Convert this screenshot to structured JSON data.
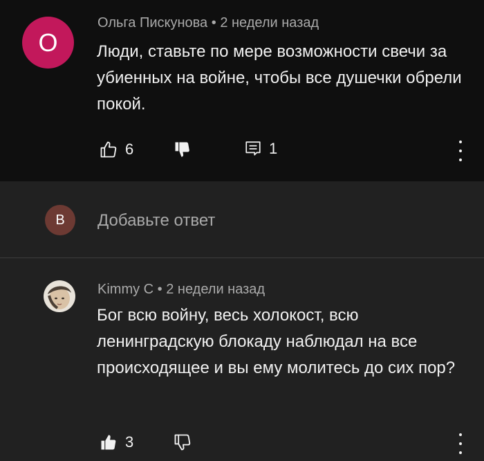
{
  "comment1": {
    "avatar_letter": "О",
    "avatar_color": "#c2185b",
    "author": "Ольга Пискунова",
    "separator": "•",
    "time": "2 недели назад",
    "text": "Люди, ставьте по мере возможности свечи за убиенных на войне, чтобы все душечки обрели покой.",
    "likes": "6",
    "replies": "1"
  },
  "reply_box": {
    "avatar_letter": "B",
    "avatar_color": "#6d3a33",
    "placeholder": "Добавьте ответ"
  },
  "comment2": {
    "author": "Kimmy C",
    "separator": "•",
    "time": "2 недели назад",
    "text": "Бог всю войну, весь холокост, всю ленинградскую блокаду наблюдал на все происходящее и вы ему молитесь до сих пор?",
    "likes": "3"
  },
  "icons": {
    "like": "thumbs-up-icon",
    "dislike": "thumbs-down-icon",
    "reply": "comment-icon",
    "more": "more-vertical-icon"
  }
}
